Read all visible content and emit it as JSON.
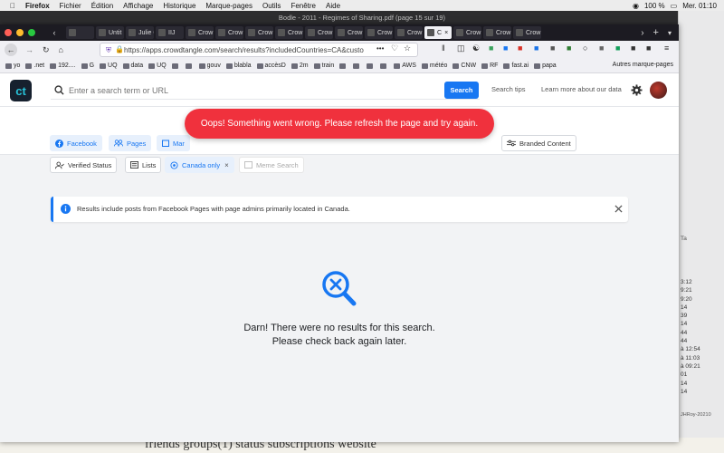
{
  "system_menubar": {
    "app_name": "Firefox",
    "items": [
      "Fichier",
      "Édition",
      "Affichage",
      "Historique",
      "Marque-pages",
      "Outils",
      "Fenêtre",
      "Aide"
    ],
    "battery": "100 %",
    "clock": "Mer. 01:10"
  },
  "background_window": {
    "title": "Bodle - 2011 - Regimes of Sharing.pdf (page 15 sur 19)",
    "bottom_text": "friends groups(1)          status     subscriptions     website",
    "right_panel_times": [
      "3:12",
      "9:21",
      "9:20",
      "14",
      "39",
      "14",
      "44",
      "44",
      "à 12:54",
      "à 11:03",
      "à 09:21",
      "01",
      "14",
      "14"
    ],
    "right_panel_footer": "JHRoy-20210",
    "right_panel_header": "Ta"
  },
  "browser": {
    "tabs": [
      {
        "label": "",
        "active": false
      },
      {
        "label": "Untit",
        "active": false
      },
      {
        "label": "Julie C",
        "active": false
      },
      {
        "label": "IIJ",
        "active": false
      },
      {
        "label": "Crow",
        "active": false
      },
      {
        "label": "Crow",
        "active": false
      },
      {
        "label": "Crow",
        "active": false
      },
      {
        "label": "Crow",
        "active": false
      },
      {
        "label": "Crow",
        "active": false
      },
      {
        "label": "Crow",
        "active": false
      },
      {
        "label": "Crow",
        "active": false
      },
      {
        "label": "Crow",
        "active": false
      },
      {
        "label": "C",
        "active": true
      },
      {
        "label": "Crow",
        "active": false
      },
      {
        "label": "Crow",
        "active": false
      },
      {
        "label": "Crow",
        "active": false
      }
    ],
    "url": "https://apps.crowdtangle.com/search/results?includedCountries=CA&custo",
    "bookmarks": [
      "yo",
      ".net",
      "192....",
      "G",
      "UQ",
      "data",
      "UQ",
      "",
      "",
      "gouv",
      "blabla",
      "accèsD",
      "2m",
      "train",
      "",
      "",
      "",
      "",
      "AWS",
      "météo",
      "CNW",
      "RF",
      "fast.ai",
      "papa"
    ],
    "other_bookmarks": "Autres marque-pages"
  },
  "app": {
    "logo_text": "ct",
    "search_placeholder": "Enter a search term or URL",
    "search_button": "Search",
    "search_tips": "Search tips",
    "learn_more": "Learn more about our data",
    "filters": {
      "facebook": "Facebook",
      "pages": "Pages",
      "more": "Mar",
      "branded": "Branded Content",
      "verified": "Verified Status",
      "lists": "Lists",
      "canada": "Canada only",
      "meme": "Meme Search"
    },
    "toast": "Oops! Something went wrong. Please refresh the page and try again.",
    "banner": "Results include posts from Facebook Pages with page admins primarily located in Canada.",
    "empty_line1": "Darn! There were no results for this search.",
    "empty_line2": "Please check back again later."
  },
  "colors": {
    "accent": "#1877f2",
    "toast": "#f0313d",
    "page_bg": "#f2f3f5"
  }
}
